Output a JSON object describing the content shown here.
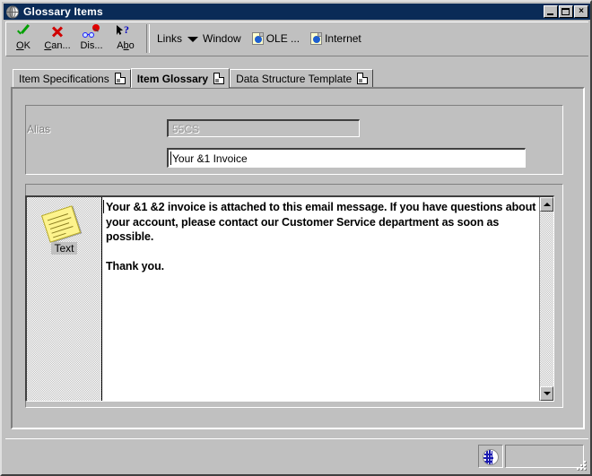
{
  "window": {
    "title": "Glossary Items",
    "icon": "globe-icon",
    "buttons": {
      "minimize": "minimize-icon",
      "maximize": "maximize-icon",
      "close": "×"
    }
  },
  "toolbar": {
    "buttons": [
      {
        "label": "OK",
        "accel": "O",
        "rest": "K",
        "icon": "check-icon"
      },
      {
        "label": "Can...",
        "accel": "C",
        "rest": "an...",
        "icon": "cancel-x-icon"
      },
      {
        "label": "Dis...",
        "accel": "",
        "rest": "Dis...",
        "icon": "display-glasses-icon"
      },
      {
        "label": "Abo",
        "accel": "",
        "rest": "Abo",
        "icon": "help-arrow-icon"
      }
    ],
    "links_label": "Links",
    "window_label": "Window",
    "link_items": [
      {
        "label": "OLE ...",
        "icon": "ole-page-globe-icon"
      },
      {
        "label": "Internet",
        "icon": "internet-page-globe-icon"
      }
    ]
  },
  "tabs": [
    {
      "label": "Item Specifications",
      "active": false
    },
    {
      "label": "Item Glossary",
      "active": true
    },
    {
      "label": "Data Structure Template",
      "active": false
    }
  ],
  "form": {
    "alias_label": "Alias",
    "alias_value": "55CS",
    "alias_placeholder": "",
    "description_value": "Your &1 Invoice",
    "description_placeholder": ""
  },
  "editor": {
    "icon_label": "Text",
    "icon": "sticky-note-icon",
    "body": "Your &1 &2 invoice is attached to this email message. If you have questions about your account, please contact our Customer Service department as soon as possible.\n\nThank you.",
    "scroll_up": "▲",
    "scroll_down": "▼"
  },
  "statusbar": {
    "globe_icon": "status-globe-icon",
    "field_value": ""
  },
  "colors": {
    "titlebar": "#0a2b57",
    "face": "#c0c0c0",
    "shadow": "#808080",
    "dark": "#404040",
    "light": "#ffffff",
    "accent_green": "#00a000",
    "accent_red": "#d00000",
    "sticky_yellow": "#fdf38d"
  }
}
